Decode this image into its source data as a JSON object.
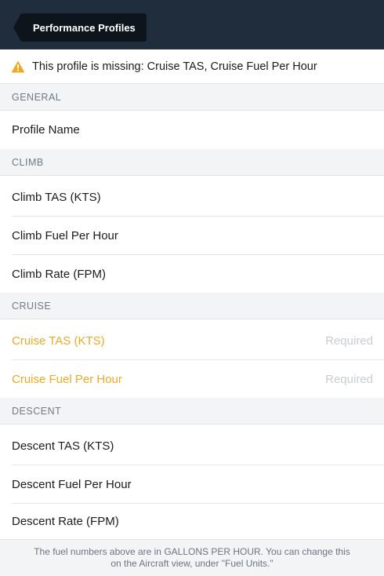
{
  "nav": {
    "back_label": "Performance Profiles"
  },
  "warning": {
    "icon": "warning-triangle-icon",
    "text": "This profile is missing: Cruise TAS, Cruise Fuel Per Hour",
    "color": "#f0a825"
  },
  "sections": {
    "general": {
      "header": "GENERAL",
      "rows": [
        {
          "label": "Profile Name",
          "value": ""
        }
      ]
    },
    "climb": {
      "header": "CLIMB",
      "rows": [
        {
          "label": "Climb TAS (KTS)",
          "value": ""
        },
        {
          "label": "Climb Fuel Per Hour",
          "value": ""
        },
        {
          "label": "Climb Rate (FPM)",
          "value": ""
        }
      ]
    },
    "cruise": {
      "header": "CRUISE",
      "rows": [
        {
          "label": "Cruise TAS (KTS)",
          "value": "Required"
        },
        {
          "label": "Cruise Fuel Per Hour",
          "value": "Required"
        }
      ]
    },
    "descent": {
      "header": "DESCENT",
      "rows": [
        {
          "label": "Descent TAS (KTS)",
          "value": ""
        },
        {
          "label": "Descent Fuel Per Hour",
          "value": ""
        },
        {
          "label": "Descent Rate (FPM)",
          "value": ""
        }
      ]
    }
  },
  "footer": {
    "note": "The fuel numbers above are in GALLONS PER HOUR. You can change this on the Aircraft view, under \"Fuel Units.\""
  }
}
